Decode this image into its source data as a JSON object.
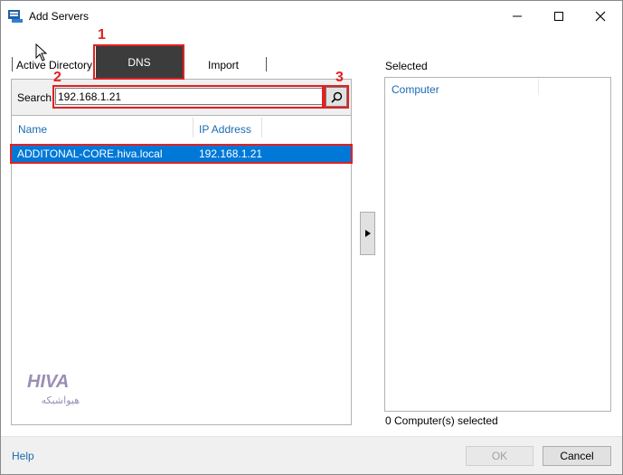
{
  "window": {
    "title": "Add Servers",
    "minimize_icon": "minimize-icon",
    "maximize_icon": "maximize-icon",
    "close_icon": "close-icon"
  },
  "tabs": [
    {
      "label": "Active Directory",
      "active": false
    },
    {
      "label": "DNS",
      "active": true
    },
    {
      "label": "Import",
      "active": false
    }
  ],
  "search": {
    "label": "Search:",
    "value": "192.168.1.21",
    "button_icon": "search-icon"
  },
  "results": {
    "columns": [
      "Name",
      "IP Address"
    ],
    "rows": [
      {
        "name": "ADDITONAL-CORE.hiva.local",
        "ip": "192.168.1.21",
        "selected": true
      }
    ]
  },
  "add_button_icon": "right-arrow-icon",
  "selected": {
    "label": "Selected",
    "column": "Computer",
    "count_text": "0 Computer(s) selected"
  },
  "annotations": {
    "step1": "1",
    "step2": "2",
    "step3": "3",
    "color": "#e32020"
  },
  "watermark": {
    "logo_text": "HIVA",
    "sub_text": "هیواشبکه"
  },
  "footer": {
    "help": "Help",
    "ok": "OK",
    "cancel": "Cancel"
  },
  "colors": {
    "selection": "#0078d7",
    "active_tab": "#3c3c3c",
    "link": "#1a6bb3"
  }
}
